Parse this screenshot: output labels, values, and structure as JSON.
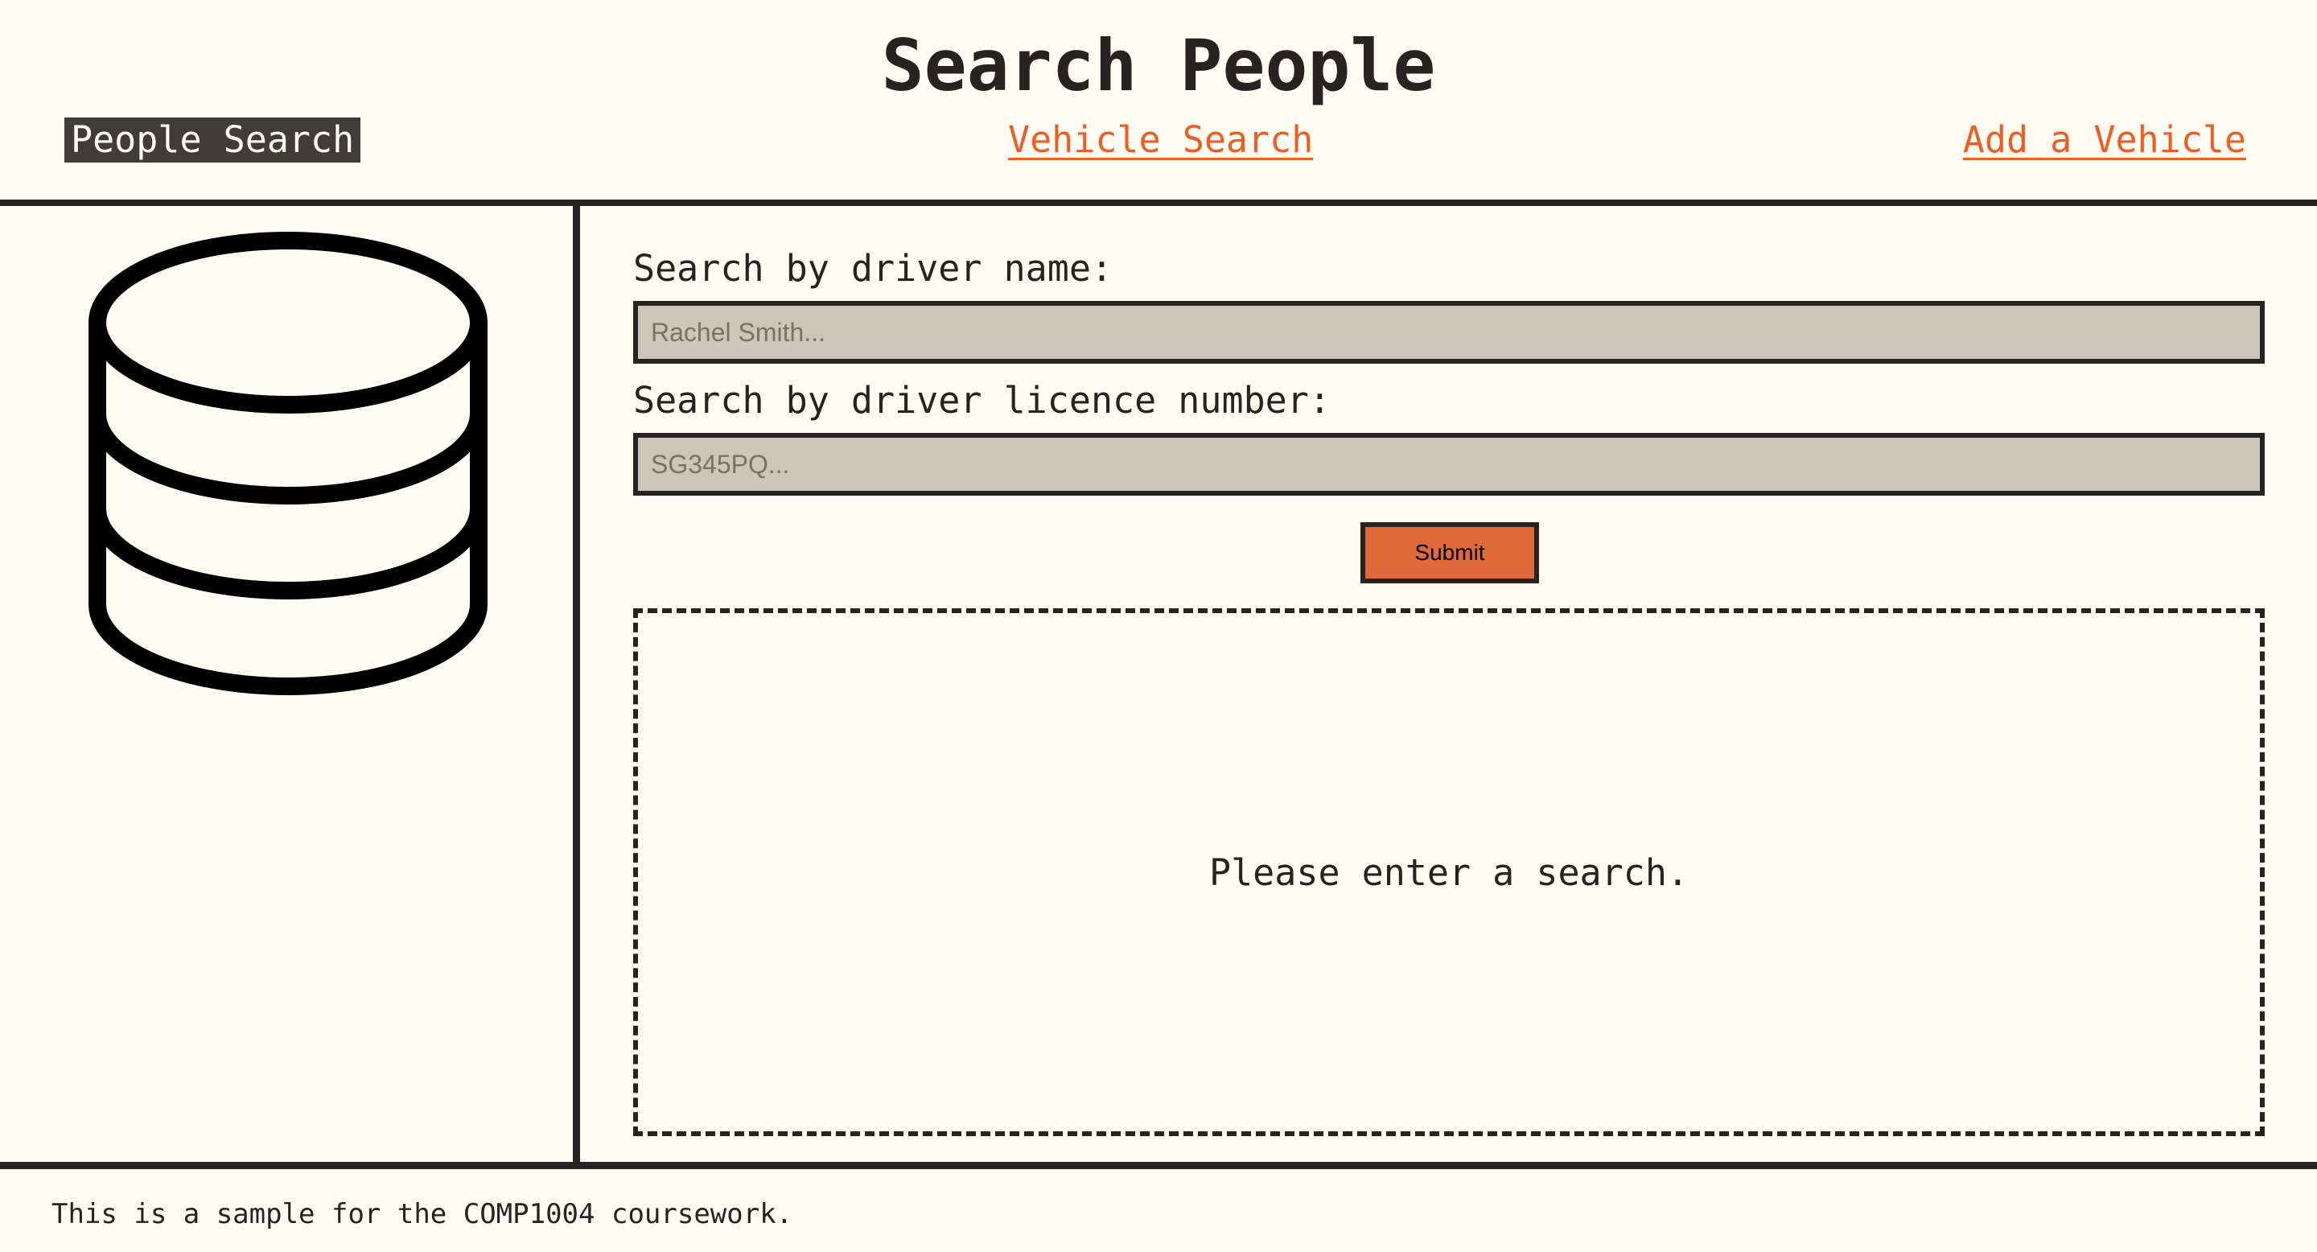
{
  "header": {
    "title": "Search People"
  },
  "nav": {
    "people_search": "People Search",
    "vehicle_search": "Vehicle Search",
    "add_vehicle": "Add a Vehicle"
  },
  "sidebar": {
    "icon": "database-icon"
  },
  "search": {
    "name_label": "Search by driver name:",
    "name_placeholder": "Rachel Smith...",
    "name_value": "",
    "licence_label": "Search by driver licence number:",
    "licence_placeholder": "SG345PQ...",
    "licence_value": "",
    "submit_label": "Submit"
  },
  "results": {
    "message": "Please enter a search."
  },
  "footer": {
    "text": "This is a sample for the COMP1004 coursework."
  },
  "colors": {
    "background": "#fffcf2",
    "text": "#252422",
    "accent": "#eb5e28",
    "input_bg": "#ccc5b9",
    "active_nav_bg": "#403d39"
  }
}
